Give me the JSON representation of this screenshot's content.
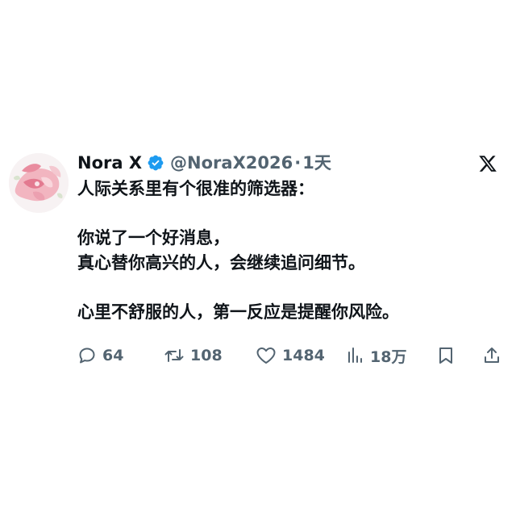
{
  "tweet": {
    "author": {
      "name": "Nora X",
      "handle": "@NoraX2026",
      "verified": true,
      "avatar_icon": "pink-flower-avatar"
    },
    "separator": "·",
    "timestamp": "1天",
    "platform_icon": "x-logo-icon",
    "lines": [
      "人际关系里有个很准的筛选器：",
      "",
      "你说了一个好消息，",
      "真心替你高兴的人，会继续追问细节。",
      "",
      "心里不舒服的人，第一反应是提醒你风险。"
    ],
    "actions": {
      "replies": "64",
      "retweets": "108",
      "likes": "1484",
      "views": "18万"
    },
    "colors": {
      "text": "#0f1419",
      "muted": "#536471",
      "verified": "#1d9bf0"
    }
  }
}
